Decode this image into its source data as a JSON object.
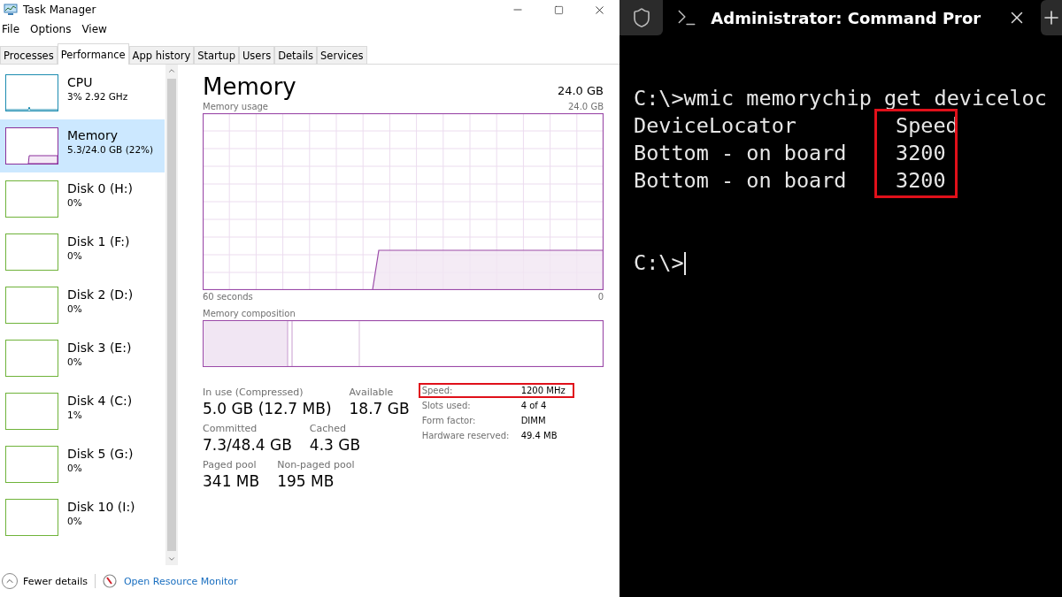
{
  "window": {
    "title": "Task Manager"
  },
  "menu": [
    "File",
    "Options",
    "View"
  ],
  "tabs": [
    {
      "label": "Processes",
      "selected": false
    },
    {
      "label": "Performance",
      "selected": true
    },
    {
      "label": "App history",
      "selected": false
    },
    {
      "label": "Startup",
      "selected": false
    },
    {
      "label": "Users",
      "selected": false
    },
    {
      "label": "Details",
      "selected": false
    },
    {
      "label": "Services",
      "selected": false
    }
  ],
  "sidebar": {
    "items": [
      {
        "kind": "cpu",
        "name": "CPU",
        "detail": "3%  2.92 GHz",
        "selected": false
      },
      {
        "kind": "memory",
        "name": "Memory",
        "detail": "5.3/24.0 GB (22%)",
        "selected": true
      },
      {
        "kind": "disk",
        "name": "Disk 0 (H:)",
        "detail": "0%",
        "selected": false
      },
      {
        "kind": "disk",
        "name": "Disk 1 (F:)",
        "detail": "0%",
        "selected": false
      },
      {
        "kind": "disk",
        "name": "Disk 2 (D:)",
        "detail": "0%",
        "selected": false
      },
      {
        "kind": "disk",
        "name": "Disk 3 (E:)",
        "detail": "0%",
        "selected": false
      },
      {
        "kind": "disk",
        "name": "Disk 4 (C:)",
        "detail": "1%",
        "selected": false
      },
      {
        "kind": "disk",
        "name": "Disk 5 (G:)",
        "detail": "0%",
        "selected": false
      },
      {
        "kind": "disk",
        "name": "Disk 10 (I:)",
        "detail": "0%",
        "selected": false
      }
    ]
  },
  "memory": {
    "title": "Memory",
    "total": "24.0 GB",
    "usage_label": "Memory usage",
    "usage_max": "24.0 GB",
    "x_start": "60 seconds",
    "x_end": "0",
    "composition_label": "Memory composition",
    "stats": [
      [
        {
          "label": "In use (Compressed)",
          "value": "5.0 GB (12.7 MB)"
        },
        {
          "label": "Available",
          "value": "18.7 GB"
        }
      ],
      [
        {
          "label": "Committed",
          "value": "7.3/48.4 GB"
        },
        {
          "label": "Cached",
          "value": "4.3 GB"
        }
      ],
      [
        {
          "label": "Paged pool",
          "value": "341 MB"
        },
        {
          "label": "Non-paged pool",
          "value": "195 MB"
        }
      ]
    ],
    "specs": [
      {
        "label": "Speed:",
        "value": "1200 MHz",
        "highlighted": true
      },
      {
        "label": "Slots used:",
        "value": "4 of 4",
        "highlighted": false
      },
      {
        "label": "Form factor:",
        "value": "DIMM",
        "highlighted": false
      },
      {
        "label": "Hardware reserved:",
        "value": "49.4 MB",
        "highlighted": false
      }
    ]
  },
  "footer": {
    "fewer_details": "Fewer details",
    "link": "Open Resource Monitor"
  },
  "terminal": {
    "tab_title": "Administrator: Command Pror",
    "command": "C:\\>wmic memorychip get deviceloc",
    "columns": [
      "DeviceLocator",
      "Speed"
    ],
    "rows": [
      [
        "Bottom - on board",
        "3200"
      ],
      [
        "Bottom - on board",
        "3200"
      ]
    ],
    "speed_highlighted": true,
    "prompt": "C:\\>"
  }
}
